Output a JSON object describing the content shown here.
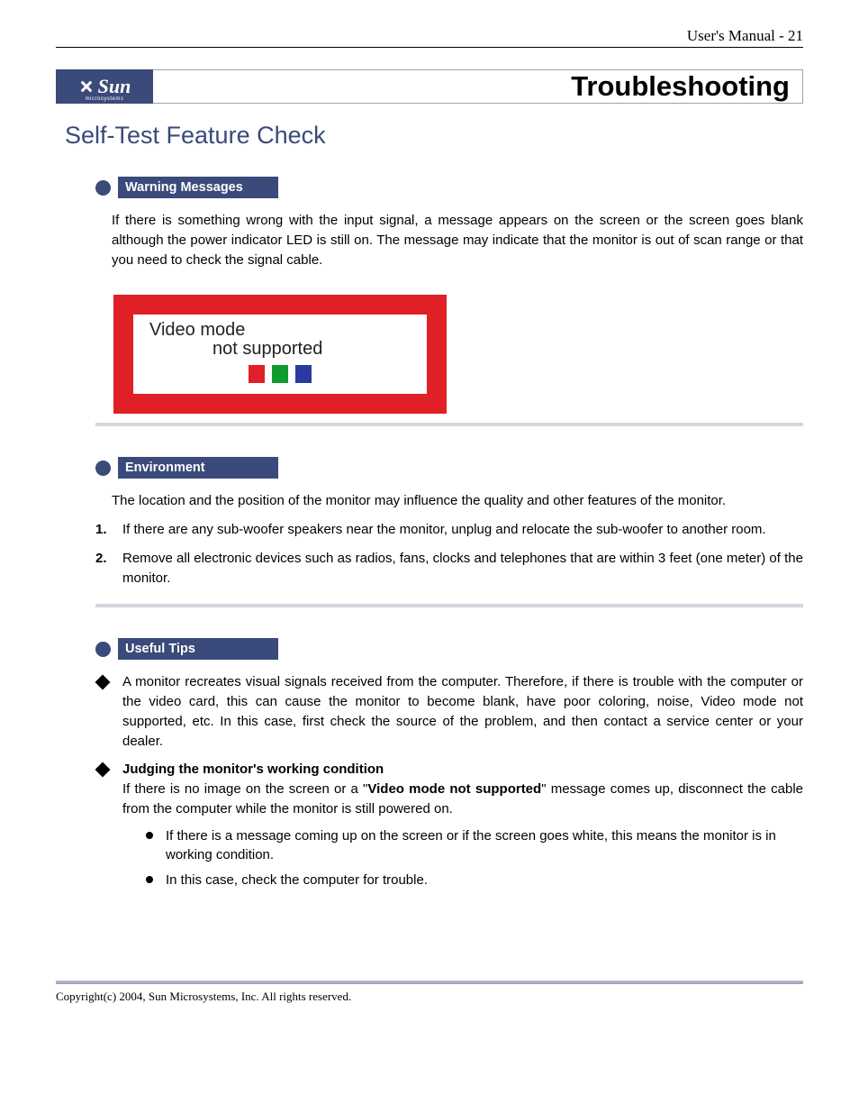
{
  "header": {
    "running_head": "User's Manual - 21",
    "logo_text": "Sun",
    "logo_sub": "microsystems",
    "chapter_title": "Troubleshooting",
    "section_title": "Self-Test Feature Check"
  },
  "sections": {
    "warning": {
      "tag": "Warning Messages",
      "body": "If there is something wrong with the input signal, a message appears on the screen or the screen goes blank although the power indicator LED is still on. The message may indicate that the monitor is out of scan range or that you need to check the signal cable.",
      "graphic": {
        "line1": "Video mode",
        "line2": "not supported"
      }
    },
    "environment": {
      "tag": "Environment",
      "body": "The location and the position of the monitor may influence the quality and other features of the monitor.",
      "items": [
        "If there are any sub-woofer speakers near the monitor, unplug and relocate the sub-woofer to another room.",
        "Remove all electronic devices such as radios, fans, clocks and telephones that are within 3 feet (one meter) of the monitor."
      ]
    },
    "tips": {
      "tag": "Useful Tips",
      "item1": "A monitor recreates visual signals received from the computer. Therefore, if there is trouble with the computer or the video card, this can cause the monitor to become blank, have poor coloring, noise, Video mode not supported, etc. In this case, first check the source of the problem, and then contact a service center or your dealer.",
      "item2_head": "Judging the monitor's working condition",
      "item2_body_pre": "If there is no image on the screen or a \"",
      "item2_body_bold": "Video mode not supported",
      "item2_body_post": "\" message comes up, disconnect the cable from the computer while the monitor is still powered on.",
      "sub_items": [
        "If there is a message coming up on the screen or if the screen goes white, this means the monitor is in working condition.",
        "In this case, check the computer for trouble."
      ]
    }
  },
  "footer": {
    "copyright": "Copyright(c) 2004, Sun Microsystems, Inc. All rights reserved."
  }
}
